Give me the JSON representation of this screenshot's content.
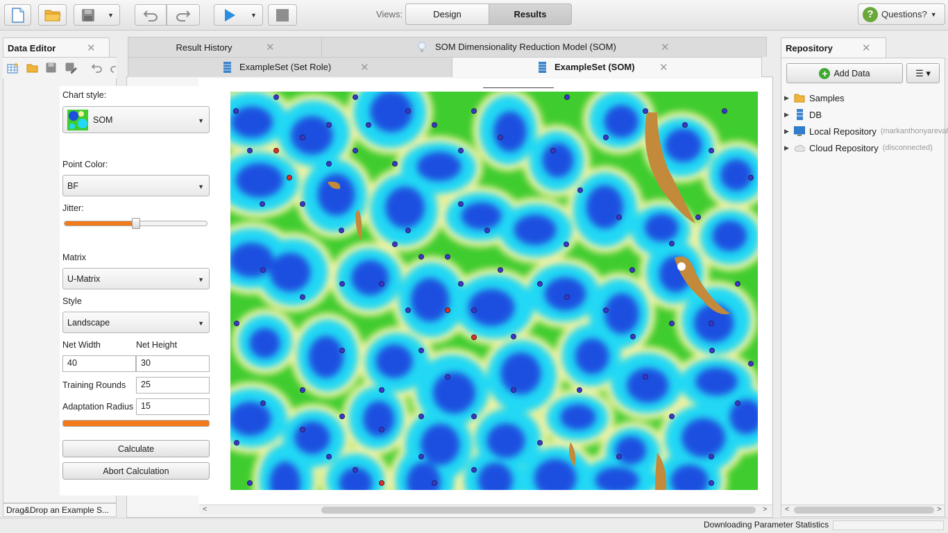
{
  "toolbar": {
    "views_label": "Views:",
    "design_label": "Design",
    "results_label": "Results",
    "questions_label": "Questions?"
  },
  "data_editor": {
    "tab_label": "Data Editor",
    "status": "Drag&Drop an Example S..."
  },
  "results": {
    "tabs_row1": [
      "Result History",
      "SOM Dimensionality Reduction Model (SOM)"
    ],
    "tabs_row2": [
      "ExampleSet (Set Role)",
      "ExampleSet (SOM)"
    ]
  },
  "chart_controls": {
    "chart_style_label": "Chart style:",
    "chart_style_value": "SOM",
    "point_color_label": "Point Color:",
    "point_color_value": "BF",
    "jitter_label": "Jitter:",
    "jitter_level": 0.5,
    "matrix_label": "Matrix",
    "matrix_value": "U-Matrix",
    "style_label": "Style",
    "style_value": "Landscape",
    "net_width_label": "Net Width",
    "net_width_value": "40",
    "net_height_label": "Net Height",
    "net_height_value": "30",
    "training_rounds_label": "Training Rounds",
    "training_rounds_value": "25",
    "adaptation_radius_label": "Adaptation Radius",
    "adaptation_radius_value": "15",
    "progress": 1.0,
    "calculate_label": "Calculate",
    "abort_label": "Abort Calculation"
  },
  "repository": {
    "tab_label": "Repository",
    "add_data_label": "Add Data",
    "items": [
      {
        "label": "Samples",
        "sub": "",
        "icon": "folder-icon"
      },
      {
        "label": "DB",
        "sub": "",
        "icon": "database-icon"
      },
      {
        "label": "Local Repository",
        "sub": "(markanthonyarevalo",
        "icon": "computer-icon"
      },
      {
        "label": "Cloud Repository",
        "sub": "(disconnected)",
        "icon": "cloud-icon"
      }
    ]
  },
  "status": {
    "message": "Downloading Parameter Statistics"
  },
  "colors": {
    "accent": "#f07a1c",
    "map_blue": "#1a4fe0",
    "map_cyan": "#22d8f4",
    "map_yellow": "#f8f3a0",
    "map_green": "#3fcc2e",
    "map_brown": "#c28a3a",
    "point_blue": "#3a36c8",
    "point_red": "#d8302a"
  }
}
